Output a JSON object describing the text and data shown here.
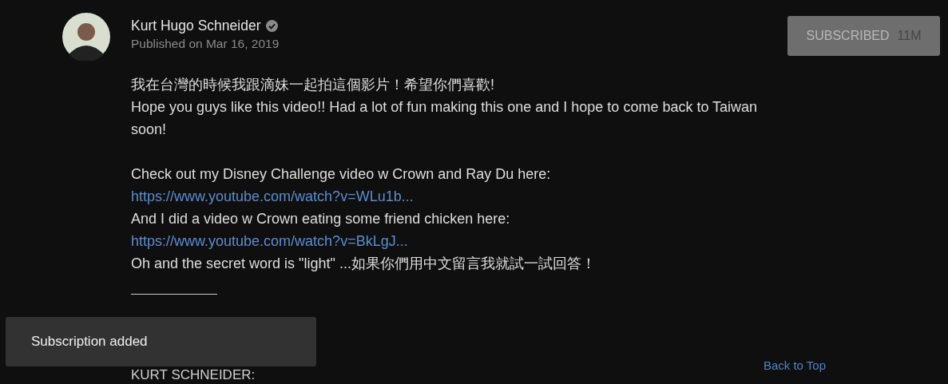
{
  "channel": {
    "name": "Kurt Hugo Schneider",
    "verified": true,
    "published": "Published on Mar 16, 2019"
  },
  "subscribe_button": {
    "label": "SUBSCRIBED",
    "count": "11M",
    "subscribed": true
  },
  "description": [
    {
      "kind": "text",
      "text": "我在台灣的時候我跟滴妹一起拍這個影片！希望你們喜歡!"
    },
    {
      "kind": "text",
      "text": "Hope you guys like this video!! Had a lot of fun making this one and I hope to come back to Taiwan soon!"
    },
    {
      "kind": "blank"
    },
    {
      "kind": "text",
      "text": "Check out my Disney Challenge video w Crown and Ray Du here:"
    },
    {
      "kind": "link",
      "text": "https://www.youtube.com/watch?v=WLu1b..."
    },
    {
      "kind": "text",
      "text": "And I did a video w Crown eating some friend chicken here:"
    },
    {
      "kind": "link",
      "text": "https://www.youtube.com/watch?v=BkLgJ..."
    },
    {
      "kind": "text",
      "text": "Oh and the secret word is \"light\" ...如果你們用中文留言我就試一試回答！"
    },
    {
      "kind": "rule"
    }
  ],
  "section_heading": "KURT SCHNEIDER:",
  "back_to_top": "Back to Top",
  "toast": {
    "message": "Subscription added"
  }
}
